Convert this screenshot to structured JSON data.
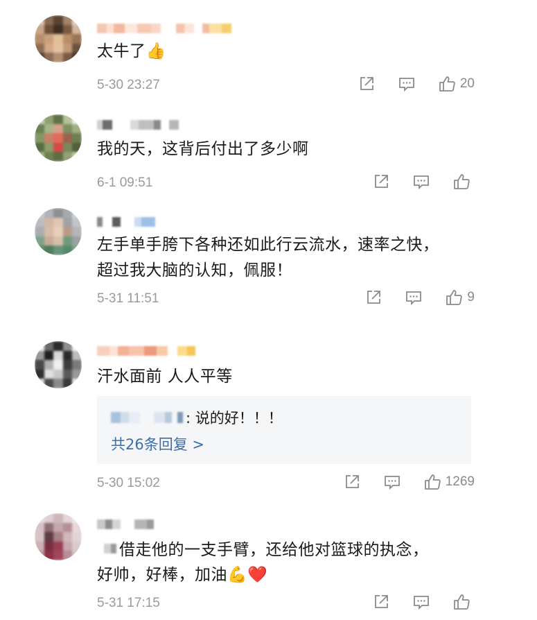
{
  "comments": [
    {
      "text": "太牛了👍",
      "time": "5-30 23:27",
      "likes": "20"
    },
    {
      "text": "我的天，这背后付出了多少啊",
      "time": "6-1 09:51",
      "likes": ""
    },
    {
      "text_line1": "左手单手胯下各种还如此行云流水，速率之快，",
      "text_line2": "超过我大脑的认知，佩服！",
      "time": "5-31 11:51",
      "likes": "9"
    },
    {
      "text": "汗水面前 人人平等",
      "reply_text": ": 说的好！！！",
      "reply_more": "共26条回复 >",
      "time": "5-30 15:02",
      "likes": "1269"
    },
    {
      "text_line1": "借走他的一支手臂，还给他对篮球的执念，",
      "text_line2": "好帅，好棒，加油💪❤️",
      "time": "5-31 17:15",
      "likes": ""
    }
  ],
  "icons": {
    "share": "share-icon",
    "comment": "comment-icon",
    "like": "thumbs-up-icon"
  },
  "colors": {
    "link": "#3d6da6",
    "meta": "#9a9a9a",
    "reply_bg": "#f5f6f7"
  }
}
